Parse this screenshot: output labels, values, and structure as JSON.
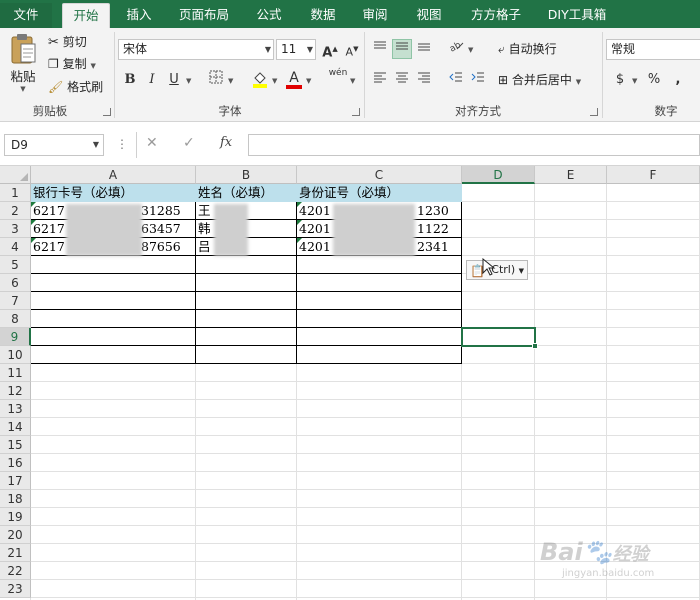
{
  "ribbon": {
    "tabs": [
      "文件",
      "开始",
      "插入",
      "页面布局",
      "公式",
      "数据",
      "审阅",
      "视图",
      "方方格子",
      "DIY工具箱"
    ],
    "active_tab": "开始",
    "clipboard": {
      "paste": "粘贴",
      "cut": "剪切",
      "copy": "复制",
      "format_painter": "格式刷",
      "group": "剪贴板"
    },
    "font": {
      "name": "宋体",
      "size": "11",
      "bold": "B",
      "italic": "I",
      "underline": "U",
      "font_color_label": "A",
      "phonetic": "wén",
      "group": "字体"
    },
    "alignment": {
      "wrap_text": "自动换行",
      "merge_center": "合并后居中",
      "group": "对齐方式"
    },
    "number": {
      "format": "常规",
      "currency": "$",
      "percent": "%",
      "comma": ",",
      "group": "数字"
    }
  },
  "formula_bar": {
    "name_box": "D9",
    "cancel_icon": "✕",
    "enter_icon": "✓",
    "fx": "fx",
    "content": ""
  },
  "sheet": {
    "columns": [
      "A",
      "B",
      "C",
      "D",
      "E",
      "F"
    ],
    "selected_column": "D",
    "rows": [
      "1",
      "2",
      "3",
      "4",
      "5",
      "6",
      "7",
      "8",
      "9",
      "10",
      "11",
      "12",
      "13",
      "14",
      "15",
      "16",
      "17",
      "18",
      "19",
      "20",
      "21",
      "22",
      "23"
    ],
    "selected_row": "9",
    "headers": {
      "a": "银行卡号（必填）",
      "b": "姓名（必填）",
      "c": "身份证号（必填）"
    },
    "data": [
      {
        "a_start": "6217",
        "a_end": "31285",
        "b": "王",
        "c_start": "4201",
        "c_end": "1230"
      },
      {
        "a_start": "6217",
        "a_end": "63457",
        "b": "韩",
        "c_start": "4201",
        "c_end": "1122"
      },
      {
        "a_start": "6217",
        "a_end": "87656",
        "b": "吕",
        "c_start": "4201",
        "c_end": "2341"
      }
    ],
    "paste_options": "(Ctrl)"
  },
  "watermark": {
    "brand": "Bai",
    "brand2": "经验",
    "url": "jingyan.baidu.com"
  },
  "colors": {
    "excel_green": "#217346",
    "header_fill": "#bde0ec"
  }
}
